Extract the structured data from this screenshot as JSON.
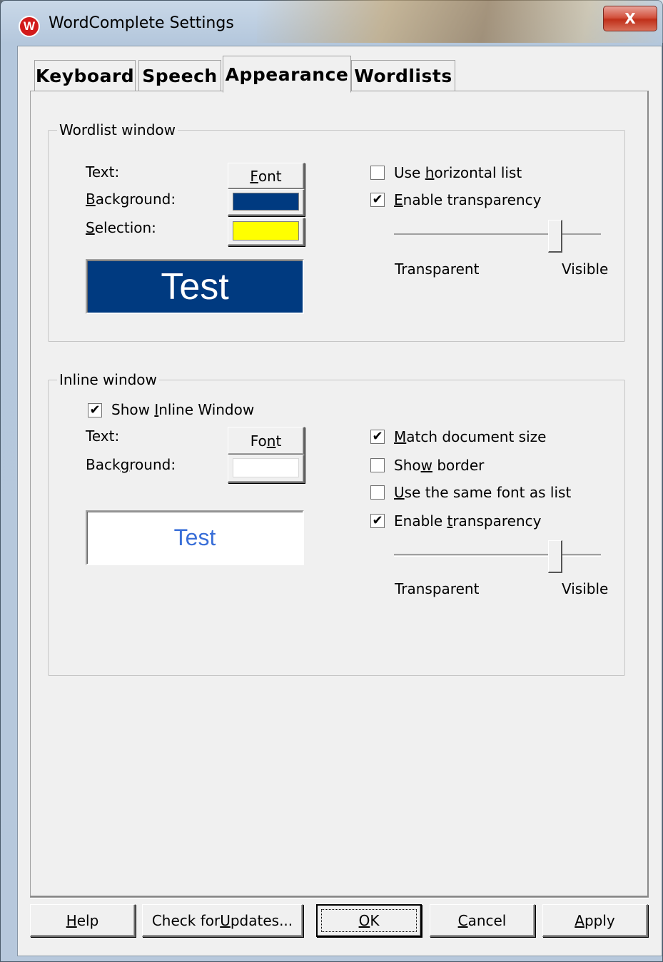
{
  "window": {
    "title": "WordComplete Settings",
    "app_icon_letter": "W",
    "close_glyph": "X"
  },
  "tabs": [
    {
      "label": "Keyboard",
      "active": false
    },
    {
      "label": "Speech",
      "active": false
    },
    {
      "label": "Appearance",
      "active": true
    },
    {
      "label": "Wordlists",
      "active": false
    }
  ],
  "wordlist_window": {
    "group_label": "Wordlist window",
    "text_label": "Text:",
    "background_label_pre": "",
    "background_label_u": "B",
    "background_label_post": "ackground:",
    "selection_label_pre": "",
    "selection_label_u": "S",
    "selection_label_post": "election:",
    "font_btn_pre": "",
    "font_btn_u": "F",
    "font_btn_post": "ont",
    "background_color": "#003a80",
    "selection_color": "#ffff00",
    "preview_text": "Test",
    "preview_bg": "#003a80",
    "preview_fg": "#ffffff",
    "use_horizontal_list_pre": "Use ",
    "use_horizontal_list_u": "h",
    "use_horizontal_list_post": "orizontal list",
    "use_horizontal_list_checked": false,
    "enable_transparency_pre": "",
    "enable_transparency_u": "E",
    "enable_transparency_post": "nable transparency",
    "enable_transparency_checked": true,
    "slider_value_percent": 80,
    "slider_min_label": "Transparent",
    "slider_max_label": "Visible"
  },
  "inline_window": {
    "group_label": "Inline window",
    "show_inline_pre": "Show ",
    "show_inline_u": "I",
    "show_inline_post": "nline Window",
    "show_inline_checked": true,
    "text_label": "Text:",
    "background_label_pre": "Back",
    "background_label_u": "g",
    "background_label_post": "round:",
    "font_btn_pre": "Fo",
    "font_btn_u": "n",
    "font_btn_post": "t",
    "background_color": "#ffffff",
    "preview_text": "Test",
    "preview_bg": "#ffffff",
    "preview_fg": "#3a6fd8",
    "match_doc_pre": "",
    "match_doc_u": "M",
    "match_doc_post": "atch document size",
    "match_doc_checked": true,
    "show_border_pre": "Sho",
    "show_border_u": "w",
    "show_border_post": " border",
    "show_border_checked": false,
    "same_font_pre": "",
    "same_font_u": "U",
    "same_font_post": "se the same font as list",
    "same_font_checked": false,
    "enable_transparency_pre": "Enable ",
    "enable_transparency_u": "t",
    "enable_transparency_post": "ransparency",
    "enable_transparency_checked": true,
    "slider_value_percent": 80,
    "slider_min_label": "Transparent",
    "slider_max_label": "Visible"
  },
  "footer": {
    "help_u": "H",
    "help_post": "elp",
    "updates_pre": "Check for ",
    "updates_u": "U",
    "updates_post": "pdates...",
    "ok_u": "O",
    "ok_post": "K",
    "cancel_u": "C",
    "cancel_post": "ancel",
    "apply_u": "A",
    "apply_post": "pply"
  },
  "colors": {
    "check_glyph": "✔"
  }
}
